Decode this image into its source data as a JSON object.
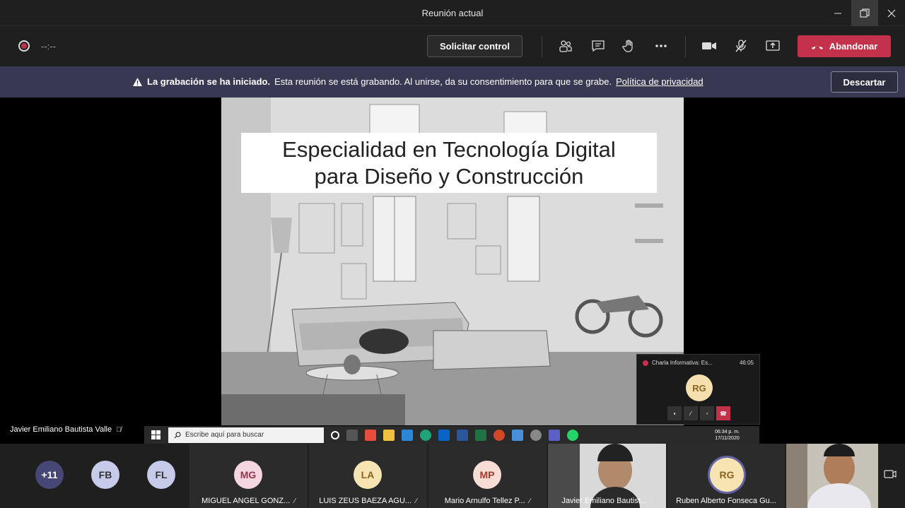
{
  "window": {
    "title": "Reunión actual",
    "controls": [
      "minimize-icon",
      "restore-icon",
      "close-icon"
    ]
  },
  "toolbar": {
    "timer": "--:--",
    "request_control_label": "Solicitar control",
    "leave_label": "Abandonar",
    "colors": {
      "leave": "#c4314b"
    },
    "icons": [
      "participants-icon",
      "chat-icon",
      "raise-hand-icon",
      "more-options-icon",
      "camera-icon",
      "mic-off-icon",
      "share-screen-icon"
    ]
  },
  "banner": {
    "bold_text": "La grabación se ha iniciado.",
    "text": "Esta reunión se está grabando. Al unirse, da su consentimiento para que se grabe.",
    "link": "Política de privacidad",
    "dismiss_label": "Descartar"
  },
  "slide": {
    "title_line1": "Especialidad en Tecnología Digital",
    "title_line2": "para Diseño y Construcción"
  },
  "presenter": {
    "name": "Javier Emiliano Bautista Valle"
  },
  "taskbar": {
    "search_placeholder": "Escribe aquí para buscar",
    "time": "06:34 p. m.",
    "date": "17/11/2020"
  },
  "mini_window": {
    "title": "Charla Informativa: Es...",
    "time": "46:05",
    "avatar_initials": "RG"
  },
  "gallery": {
    "overflow_count": "+11",
    "small_avatars": [
      "FB",
      "FL"
    ],
    "tiles": [
      {
        "initials": "MG",
        "name": "MIGUEL ANGEL GONZ..."
      },
      {
        "initials": "LA",
        "name": "LUIS ZEUS BAEZA AGU..."
      },
      {
        "initials": "MP",
        "name": "Mario Arnulfo Tellez P..."
      },
      {
        "initials": "",
        "name": "Javier Emiliano Bautist..."
      },
      {
        "initials": "RG",
        "name": "Ruben Alberto Fonseca Gu..."
      }
    ]
  }
}
